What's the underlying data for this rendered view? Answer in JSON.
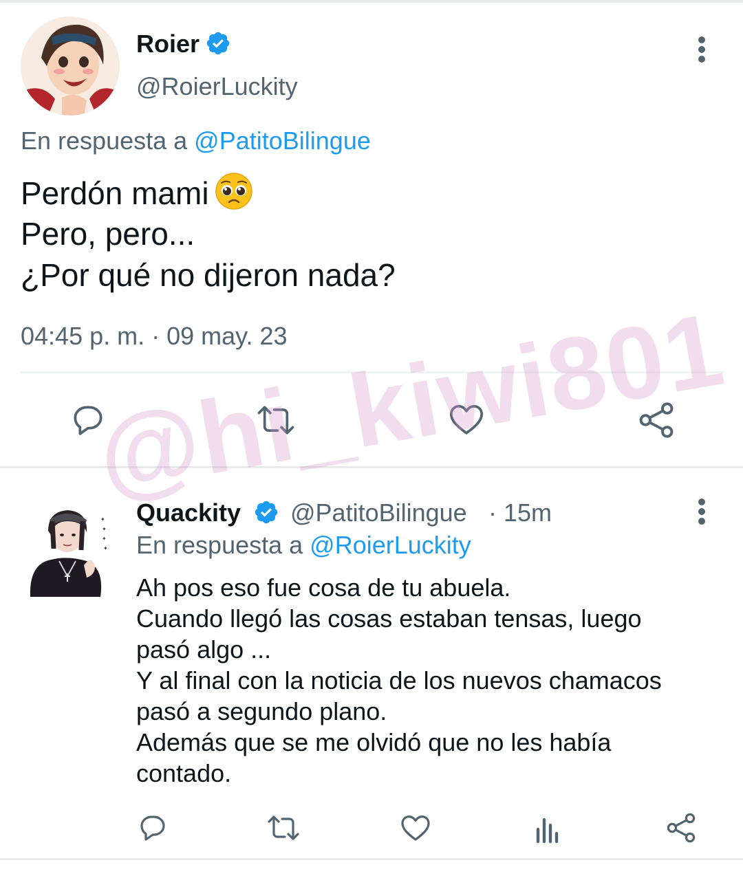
{
  "tweet": {
    "author_name": "Roier",
    "author_handle": "@RoierLuckity",
    "reply_prefix": "En respuesta a",
    "reply_mention": "@PatitoBilingue",
    "text_lines": [
      "Perdón mami",
      "Pero, pero...",
      "¿Por qué no dijeron nada?"
    ],
    "emoji": "pleading-face",
    "timestamp": "04:45 p. m. · 09 may. 23"
  },
  "reply": {
    "author_name": "Quackity",
    "author_handle": "@PatitoBilingue",
    "time": "· 15m",
    "reply_prefix": "En respuesta a",
    "reply_mention": "@RoierLuckity",
    "text_lines": [
      "Ah pos eso fue cosa de tu abuela.",
      "Cuando llegó las cosas estaban tensas, luego",
      "pasó algo ...",
      "Y al final con la noticia de los nuevos chamacos",
      "pasó a segundo plano.",
      "Además que se me olvidó que no les había",
      "contado."
    ]
  },
  "watermark": "@hi_kiwi801",
  "colors": {
    "accent": "#1d9bf0",
    "secondary_text": "#536471",
    "icon": "#536471"
  }
}
